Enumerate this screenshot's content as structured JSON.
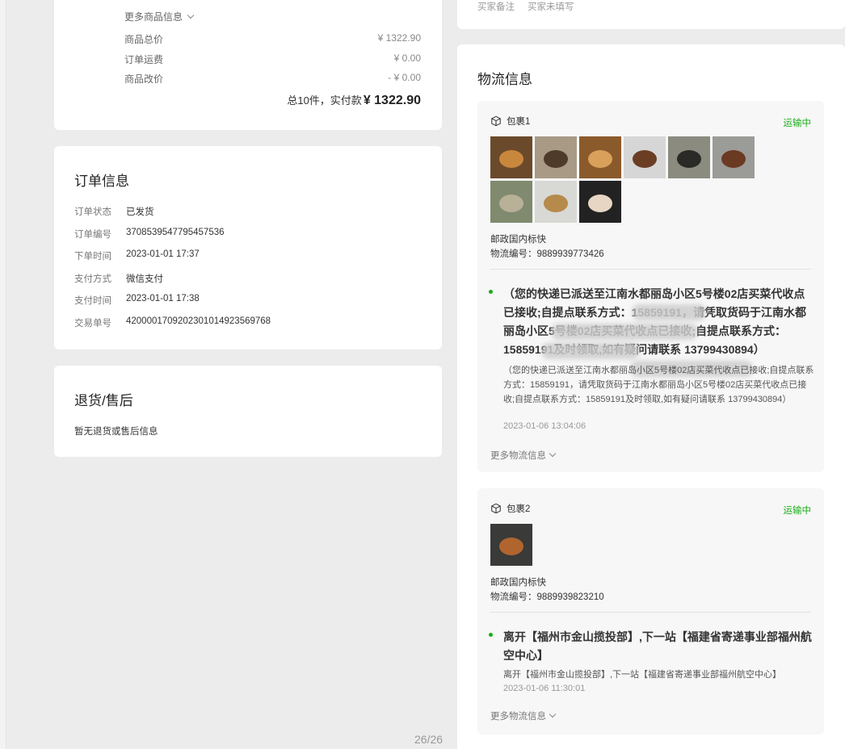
{
  "prices": {
    "more_goods_label": "更多商品信息",
    "rows": [
      {
        "label": "商品总价",
        "value": "¥ 1322.90"
      },
      {
        "label": "订单运费",
        "value": "¥ 0.00"
      },
      {
        "label": "商品改价",
        "value": "- ¥ 0.00"
      }
    ],
    "total_prefix": "总10件，实付款",
    "total_amount": "¥ 1322.90"
  },
  "order_info": {
    "title": "订单信息",
    "rows": [
      {
        "label": "订单状态",
        "value": "已发货"
      },
      {
        "label": "订单编号",
        "value": "3708539547795457536"
      },
      {
        "label": "下单时间",
        "value": "2023-01-01 17:37"
      },
      {
        "label": "支付方式",
        "value": "微信支付"
      },
      {
        "label": "支付时间",
        "value": "2023-01-01 17:38"
      },
      {
        "label": "交易单号",
        "value": "4200001709202301014923569768"
      }
    ]
  },
  "returns": {
    "title": "退货/售后",
    "empty_text": "暂无退货或售后信息"
  },
  "top_right": {
    "label": "买家备注",
    "value": "买家未填写"
  },
  "logistics": {
    "title": "物流信息",
    "packages": [
      {
        "name": "包裹1",
        "status": "运输中",
        "thumbs": [
          {
            "name": "bamboo-cup-thumb",
            "bg": "#6b4a2b",
            "fg": "#c9873e"
          },
          {
            "name": "tea-cups-rack-thumb",
            "bg": "#a89a85",
            "fg": "#4e3b2a"
          },
          {
            "name": "wooden-tea-set-thumb",
            "bg": "#8b5a2b",
            "fg": "#d9a05b"
          },
          {
            "name": "tea-scoop-thumb",
            "bg": "#d6d6d6",
            "fg": "#6b3e24"
          },
          {
            "name": "lotus-tray-thumb",
            "bg": "#8b8b80",
            "fg": "#2a2a26"
          },
          {
            "name": "tea-pick-thumb",
            "bg": "#9b9b98",
            "fg": "#6b3a22"
          },
          {
            "name": "painted-mat-thumb",
            "bg": "#7f8a6e",
            "fg": "#b8b097"
          },
          {
            "name": "bamboo-chopsticks-thumb",
            "bg": "#d8d8d5",
            "fg": "#b68a4a"
          },
          {
            "name": "black-scoop-thumb",
            "bg": "#222222",
            "fg": "#e8d6c4"
          }
        ],
        "carrier": "邮政国内标快",
        "tracking": "物流编号：9889939773426",
        "latest_title": "（您的快递已派送至江南水都丽岛小区5号楼02店买菜代收点已接收;自提点联系方式：15859191，请凭取货码于江南水都丽岛小区5号楼02店买菜代收点已接收;自提点联系方式：15859191及时领取,如有疑问请联系 13799430894）",
        "latest_desc": "（您的快递已派送至江南水都丽岛小区5号楼02店买菜代收点已接收;自提点联系方式：15859191，请凭取货码于江南水都丽岛小区5号楼02店买菜代收点已接收;自提点联系方式：15859191及时领取,如有疑问请联系 13799430894）",
        "time": "2023-01-06 13:04:06",
        "more_label": "更多物流信息"
      },
      {
        "name": "包裹2",
        "status": "运输中",
        "thumbs": [
          {
            "name": "copper-kettle-thumb",
            "bg": "#3a3a38",
            "fg": "#b0652e"
          }
        ],
        "carrier": "邮政国内标快",
        "tracking": "物流编号：9889939823210",
        "latest_title": "离开【福州市金山揽投部】,下一站【福建省寄递事业部福州航空中心】",
        "latest_desc": "离开【福州市金山揽投部】,下一站【福建省寄递事业部福州航空中心】",
        "time": "2023-01-06 11:30:01",
        "more_label": "更多物流信息"
      }
    ]
  },
  "page_indicator": "26/26",
  "colors": {
    "background": "#ececec",
    "card": "#ffffff",
    "package_bg": "#f7f7f7",
    "status_green": "#1aad19"
  }
}
